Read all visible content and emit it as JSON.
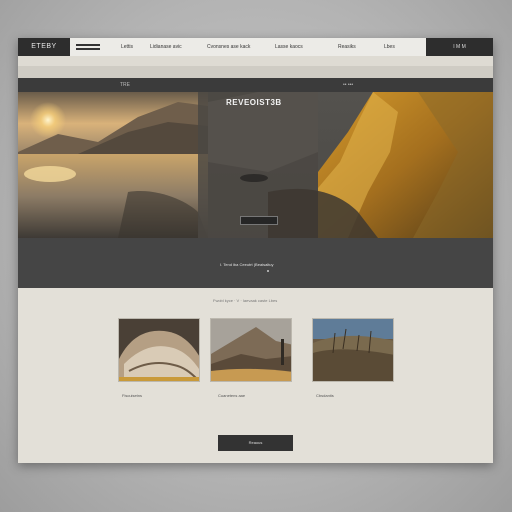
{
  "brand": {
    "name": "ETEBY"
  },
  "nav": {
    "links": [
      "Lettis",
      "Lidianase avic",
      "Cvonsnes ase kack",
      "Lasse kaocs"
    ],
    "right_links": [
      "Reasiks",
      "Lbes"
    ],
    "account": "I M M"
  },
  "hero": {
    "tab_label": "TRE",
    "tab_right": "•• •••",
    "title": "REVEOIST3B",
    "caption": "I. Tend iba Ceeutrt (Beaisaltuy"
  },
  "gallery": {
    "section_label": "Fwobl kyce · V · Iaevaak caste Lbes",
    "items": [
      {
        "caption": "Fiscuisetns"
      },
      {
        "caption": "Cuanetens aae"
      },
      {
        "caption": "Cbsdantis"
      }
    ]
  },
  "cta": {
    "label": "Reaous"
  },
  "colors": {
    "dark": "#2d2d2d",
    "page": "#e3e0d8",
    "accent_gold": "#b7862b"
  },
  "icons": [
    "menu-icon"
  ]
}
